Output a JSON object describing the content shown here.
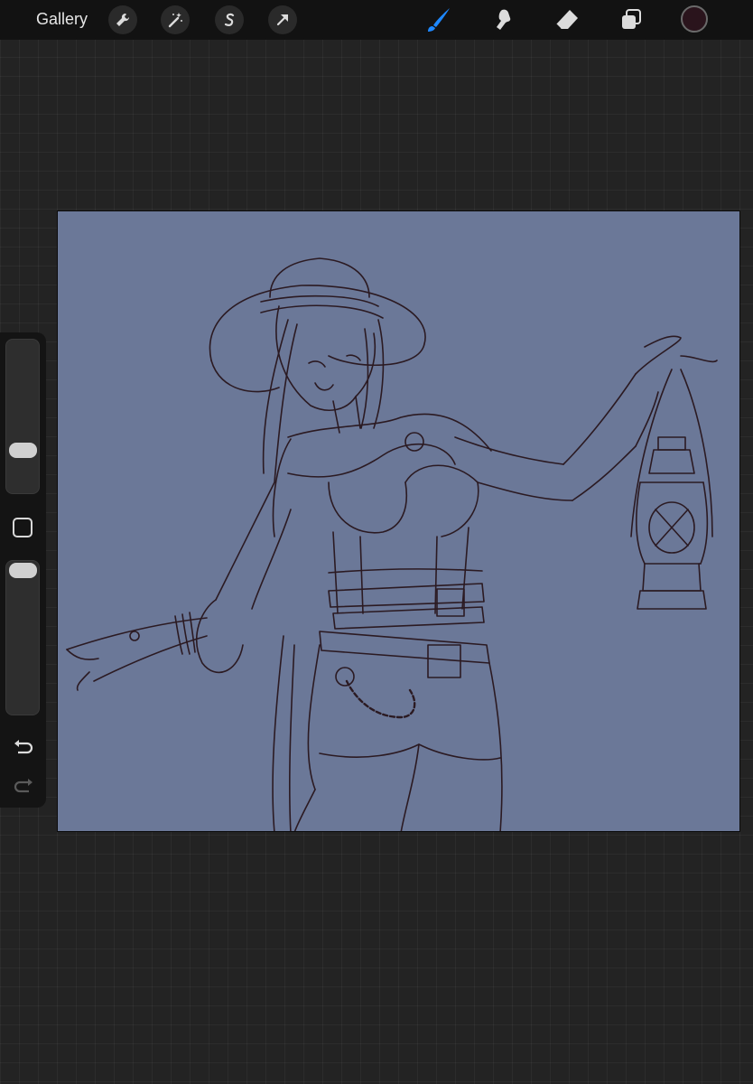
{
  "toolbar": {
    "gallery_label": "Gallery",
    "left_tools": [
      "wrench-icon",
      "magic-wand-icon",
      "selection-s-icon",
      "transform-arrow-icon"
    ],
    "right_tools": [
      "brush-icon",
      "smudge-icon",
      "eraser-icon",
      "layers-icon"
    ],
    "active_tool": "brush-icon",
    "accent_color": "#1e88ff",
    "current_color": "#2a141c"
  },
  "sidebar": {
    "brush_size_level": 0.25,
    "opacity_level": 1.0,
    "icons": [
      "modify-square-icon",
      "undo-icon",
      "redo-icon"
    ]
  },
  "canvas": {
    "background_color": "#6b7898",
    "line_color": "#2b1a22"
  }
}
